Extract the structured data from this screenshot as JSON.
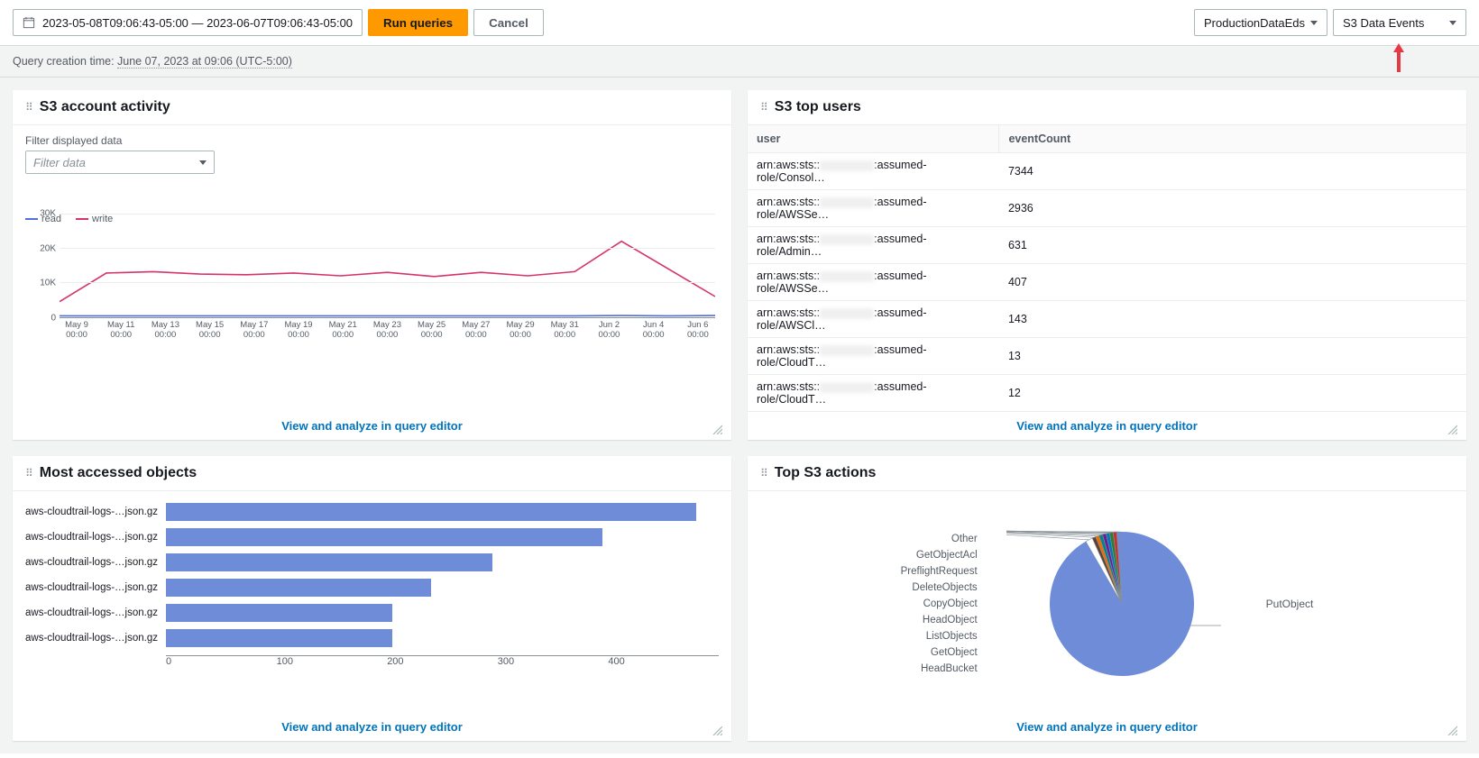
{
  "toolbar": {
    "date_range": "2023-05-08T09:06:43-05:00 — 2023-06-07T09:06:43-05:00",
    "run_queries_label": "Run queries",
    "cancel_label": "Cancel",
    "select_source": "ProductionDataEds",
    "select_events": "S3 Data Events"
  },
  "sub_header": {
    "prefix": "Query creation time: ",
    "value": "June 07, 2023 at 09:06 (UTC-5:00)"
  },
  "panels": {
    "activity": {
      "title": "S3 account activity",
      "filter_label": "Filter displayed data",
      "filter_placeholder": "Filter data",
      "link": "View and analyze in query editor",
      "legend": {
        "read": "read",
        "write": "write"
      }
    },
    "top_users": {
      "title": "S3 top users",
      "columns": {
        "user": "user",
        "count": "eventCount"
      },
      "rows": [
        {
          "prefix": "arn:aws:sts::",
          "suffix": ":assumed-role/Consol…",
          "count": "7344"
        },
        {
          "prefix": "arn:aws:sts::",
          "suffix": ":assumed-role/AWSSe…",
          "count": "2936"
        },
        {
          "prefix": "arn:aws:sts::",
          "suffix": ":assumed-role/Admin…",
          "count": "631"
        },
        {
          "prefix": "arn:aws:sts::",
          "suffix": ":assumed-role/AWSSe…",
          "count": "407"
        },
        {
          "prefix": "arn:aws:sts::",
          "suffix": ":assumed-role/AWSCl…",
          "count": "143"
        },
        {
          "prefix": "arn:aws:sts::",
          "suffix": ":assumed-role/CloudT…",
          "count": "13"
        },
        {
          "prefix": "arn:aws:sts::",
          "suffix": ":assumed-role/CloudT…",
          "count": "12"
        }
      ],
      "link": "View and analyze in query editor"
    },
    "most_accessed": {
      "title": "Most accessed objects",
      "link": "View and analyze in query editor"
    },
    "top_actions": {
      "title": "Top S3 actions",
      "link": "View and analyze in query editor",
      "dominant_label": "PutObject"
    }
  },
  "chart_data": [
    {
      "id": "activity_chart",
      "type": "line",
      "title": "S3 account activity",
      "xlabel": "",
      "ylabel": "",
      "ylim": [
        0,
        30000
      ],
      "y_ticks": [
        "0",
        "10K",
        "20K",
        "30K"
      ],
      "categories": [
        "May 9 00:00",
        "May 11 00:00",
        "May 13 00:00",
        "May 15 00:00",
        "May 17 00:00",
        "May 19 00:00",
        "May 21 00:00",
        "May 23 00:00",
        "May 25 00:00",
        "May 27 00:00",
        "May 29 00:00",
        "May 31 00:00",
        "Jun 2 00:00",
        "Jun 4 00:00",
        "Jun 6 00:00"
      ],
      "series": [
        {
          "name": "read",
          "color": "#4f6fdb",
          "values": [
            400,
            400,
            400,
            400,
            400,
            400,
            400,
            400,
            400,
            400,
            400,
            400,
            500,
            400,
            500
          ]
        },
        {
          "name": "write",
          "color": "#d6336c",
          "values": [
            4500,
            12800,
            13200,
            12500,
            12300,
            12800,
            12000,
            13000,
            11800,
            13000,
            12000,
            13200,
            22000,
            14000,
            6000
          ]
        }
      ]
    },
    {
      "id": "most_accessed_chart",
      "type": "bar",
      "title": "Most accessed objects",
      "xlabel": "",
      "ylabel": "",
      "xlim": [
        0,
        500
      ],
      "x_ticks": [
        "0",
        "100",
        "200",
        "300",
        "400"
      ],
      "categories": [
        "aws-cloudtrail-logs-…json.gz",
        "aws-cloudtrail-logs-…json.gz",
        "aws-cloudtrail-logs-…json.gz",
        "aws-cloudtrail-logs-…json.gz",
        "aws-cloudtrail-logs-…json.gz",
        "aws-cloudtrail-logs-…json.gz"
      ],
      "values": [
        480,
        395,
        295,
        240,
        205,
        205
      ],
      "color": "#6f8cd8"
    },
    {
      "id": "top_actions_chart",
      "type": "pie",
      "title": "Top S3 actions",
      "series": [
        {
          "name": "PutObject",
          "value": 92.0,
          "color": "#6f8cd8"
        },
        {
          "name": "HeadBucket",
          "value": 0.8,
          "color": "#6f8cd8"
        },
        {
          "name": "GetObject",
          "value": 0.8,
          "color": "#c9302c"
        },
        {
          "name": "ListObjects",
          "value": 0.8,
          "color": "#2e7d32"
        },
        {
          "name": "HeadObject",
          "value": 0.8,
          "color": "#0277bd"
        },
        {
          "name": "CopyObject",
          "value": 0.8,
          "color": "#6a1b9a"
        },
        {
          "name": "DeleteObjects",
          "value": 0.8,
          "color": "#00838f"
        },
        {
          "name": "PreflightRequest",
          "value": 0.8,
          "color": "#ef6c00"
        },
        {
          "name": "GetObjectAcl",
          "value": 0.8,
          "color": "#5d4037"
        },
        {
          "name": "Other",
          "value": 1.6,
          "color": "#ffffff"
        }
      ],
      "label_order": [
        "Other",
        "GetObjectAcl",
        "PreflightRequest",
        "DeleteObjects",
        "CopyObject",
        "HeadObject",
        "ListObjects",
        "GetObject",
        "HeadBucket"
      ]
    }
  ]
}
